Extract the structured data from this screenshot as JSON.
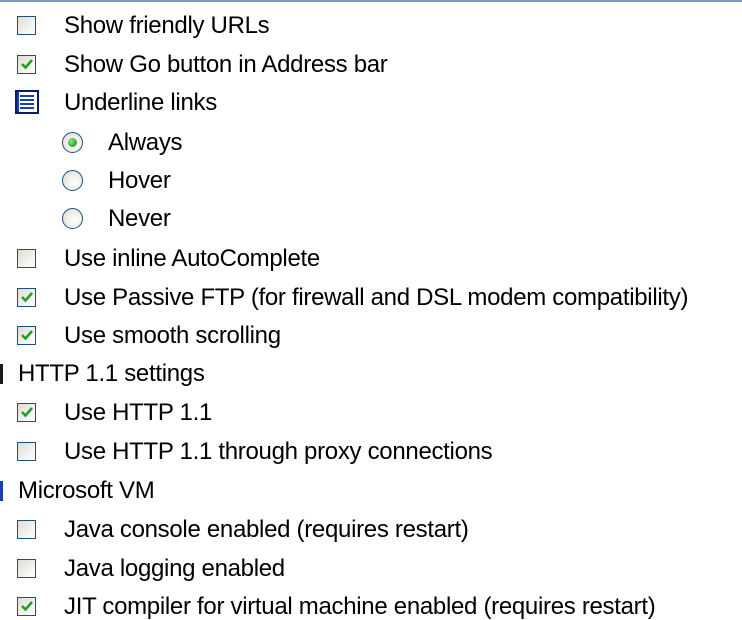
{
  "items": [
    {
      "label": "Show friendly URLs",
      "checked": false
    },
    {
      "label": "Show Go button in Address bar",
      "checked": true
    },
    {
      "label": "Underline links"
    },
    {
      "label": "Always",
      "selected": true
    },
    {
      "label": "Hover",
      "selected": false
    },
    {
      "label": "Never",
      "selected": false
    },
    {
      "label": "Use inline AutoComplete",
      "checked": false
    },
    {
      "label": "Use Passive FTP (for firewall and DSL modem compatibility)",
      "checked": true
    },
    {
      "label": "Use smooth scrolling",
      "checked": true
    },
    {
      "label": "HTTP 1.1 settings"
    },
    {
      "label": "Use HTTP 1.1",
      "checked": true
    },
    {
      "label": "Use HTTP 1.1 through proxy connections",
      "checked": false
    },
    {
      "label": "Microsoft VM"
    },
    {
      "label": "Java console enabled (requires restart)",
      "checked": false
    },
    {
      "label": "Java logging enabled",
      "checked": false
    },
    {
      "label": "JIT compiler for virtual machine enabled (requires restart)",
      "checked": true
    }
  ],
  "icons": {
    "checkbox_tick": "check-mark-icon",
    "radio_dot": "radio-dot-icon",
    "group": "settings-group-icon"
  },
  "colors": {
    "check_green": "#21a121",
    "control_border": "#1c5180",
    "group_icon_blue": "#1a3fb5",
    "radio_green": "#3fb23a"
  }
}
